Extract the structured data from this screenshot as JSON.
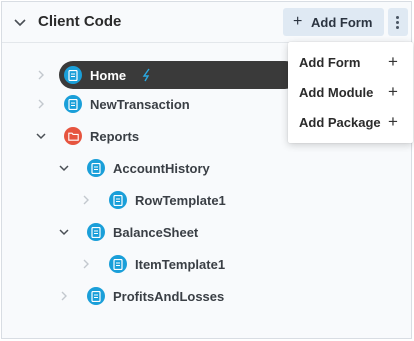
{
  "header": {
    "title": "Client Code",
    "add_form_label": "Add Form"
  },
  "tree": {
    "home": "Home",
    "new_transaction": "NewTransaction",
    "reports": "Reports",
    "account_history": "AccountHistory",
    "row_template": "RowTemplate1",
    "balance_sheet": "BalanceSheet",
    "item_template": "ItemTemplate1",
    "profits_and_losses": "ProfitsAndLosses"
  },
  "menu": {
    "items": [
      {
        "label": "Add Form"
      },
      {
        "label": "Add Module"
      },
      {
        "label": "Add Package"
      }
    ]
  },
  "colors": {
    "form_icon": "#1a9fd9",
    "folder_icon": "#e6543f",
    "selected_row": "#3a3a3a",
    "button_bg": "#dfe9f3"
  }
}
